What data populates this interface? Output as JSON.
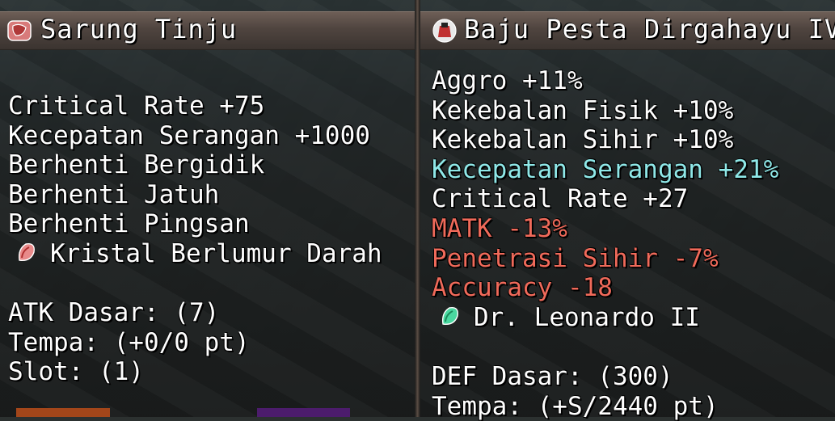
{
  "left_item": {
    "name": "Sarung Tinju",
    "icon": "glove-icon",
    "stats": [
      {
        "text": "Critical Rate +75",
        "color": "white"
      },
      {
        "text": "Kecepatan Serangan +1000",
        "color": "white"
      },
      {
        "text": "Berhenti Bergidik",
        "color": "white"
      },
      {
        "text": "Berhenti Jatuh",
        "color": "white"
      },
      {
        "text": "Berhenti Pingsan",
        "color": "white"
      }
    ],
    "crystal": {
      "icon": "red-crystal-icon",
      "text": "Kristal Berlumur Darah"
    },
    "base": [
      "ATK Dasar: (7)",
      "Tempa: (+0/0 pt)",
      "Slot: (1)"
    ]
  },
  "right_item": {
    "name": "Baju Pesta Dirgahayu IV",
    "icon": "party-dress-icon",
    "stats": [
      {
        "text": "Aggro +11%",
        "color": "white"
      },
      {
        "text": "Kekebalan Fisik +10%",
        "color": "white"
      },
      {
        "text": "Kekebalan Sihir +10%",
        "color": "white"
      },
      {
        "text": "Kecepatan Serangan +21%",
        "color": "cyan"
      },
      {
        "text": "Critical Rate +27",
        "color": "white"
      },
      {
        "text": "MATK -13%",
        "color": "red"
      },
      {
        "text": "Penetrasi Sihir -7%",
        "color": "red"
      },
      {
        "text": "Accuracy -18",
        "color": "red"
      }
    ],
    "crystal": {
      "icon": "green-crystal-icon",
      "text": "Dr. Leonardo II"
    },
    "base": [
      "DEF Dasar: (300)",
      "Tempa: (+S/2440 pt)"
    ]
  },
  "colors": {
    "white": "#ffffff",
    "cyan": "#8fe8e8",
    "red": "#f06a5a",
    "title_bar": "#4f443f"
  }
}
